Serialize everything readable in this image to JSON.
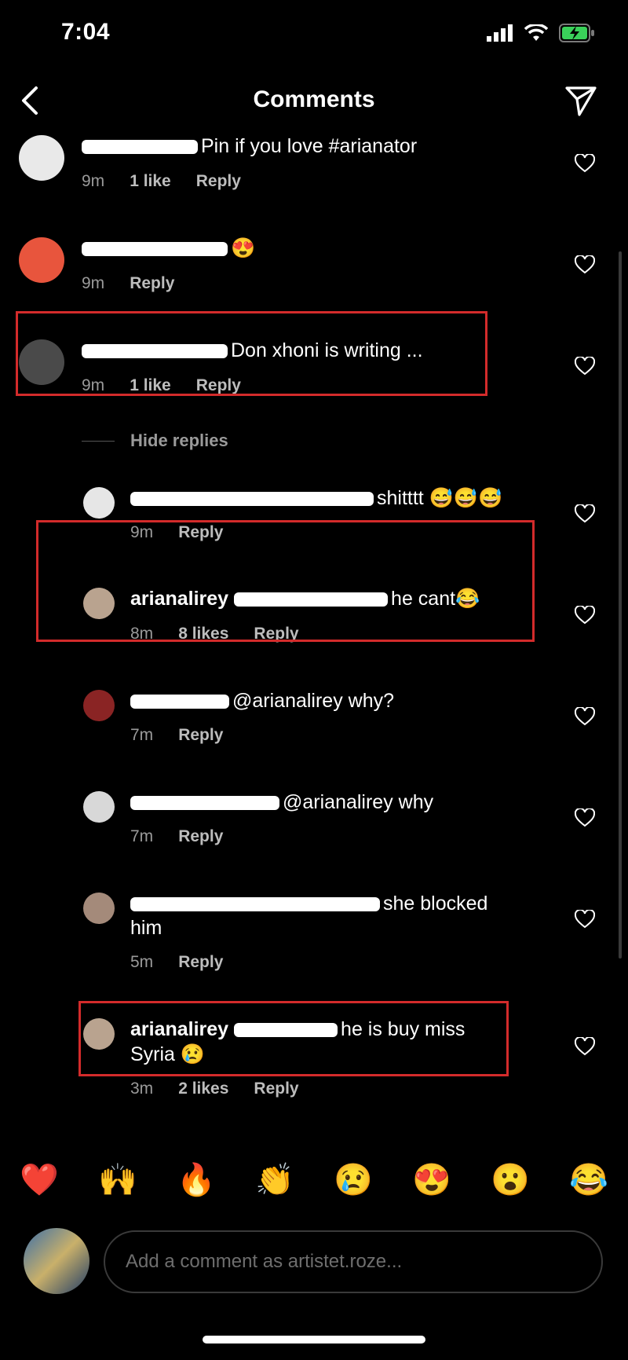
{
  "status_bar": {
    "time": "7:04"
  },
  "header": {
    "title": "Comments"
  },
  "comments": [
    {
      "text": "Pin if you love #arianator",
      "time": "9m",
      "likes": "1 like",
      "reply": "Reply"
    },
    {
      "text": "😍",
      "time": "9m",
      "reply": "Reply"
    },
    {
      "text": "Don xhoni is writing ...",
      "time": "9m",
      "likes": "1 like",
      "reply": "Reply"
    }
  ],
  "hide_replies": "Hide replies",
  "replies": [
    {
      "text": "shitttt 😅😅😅",
      "time": "9m",
      "reply": "Reply"
    },
    {
      "username": "arianalirey",
      "text": "he cant😂",
      "time": "8m",
      "likes": "8 likes",
      "reply": "Reply"
    },
    {
      "text": "@arianalirey why?",
      "time": "7m",
      "reply": "Reply"
    },
    {
      "text": "@arianalirey why",
      "time": "7m",
      "reply": "Reply"
    },
    {
      "text": "she blocked",
      "text2": "him",
      "time": "5m",
      "reply": "Reply"
    },
    {
      "username": "arianalirey",
      "text": "he is buy miss",
      "text2": "Syria 😢",
      "time": "3m",
      "likes": "2 likes",
      "reply": "Reply"
    }
  ],
  "emoji_bar": [
    "❤️",
    "🙌",
    "🔥",
    "👏",
    "😢",
    "😍",
    "😮",
    "😂"
  ],
  "comment_input": {
    "placeholder": "Add a comment as artistet.roze..."
  }
}
